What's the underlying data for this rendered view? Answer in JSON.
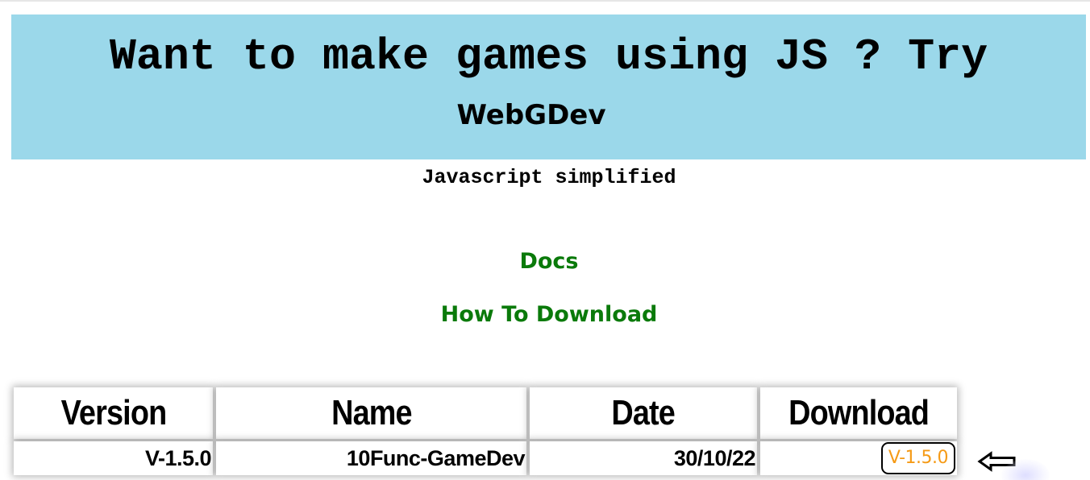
{
  "hero": {
    "headline": "Want to make games using JS ? Try",
    "brand": "WebGDev",
    "background_color": "#9bd8ea"
  },
  "tagline": "Javascript simplified",
  "nav": {
    "docs_label": "Docs",
    "how_to_download_label": "How To Download",
    "link_color": "#0a7a0a"
  },
  "table": {
    "headers": [
      "Version",
      "Name",
      "Date",
      "Download"
    ],
    "rows": [
      {
        "version": "V-1.5.0",
        "name": "10Func-GameDev",
        "date": "30/10/22",
        "download_label": "V-1.5.0"
      }
    ],
    "download_link_color": "#f59a16"
  },
  "icons": {
    "pointer": "left-arrow-icon"
  }
}
